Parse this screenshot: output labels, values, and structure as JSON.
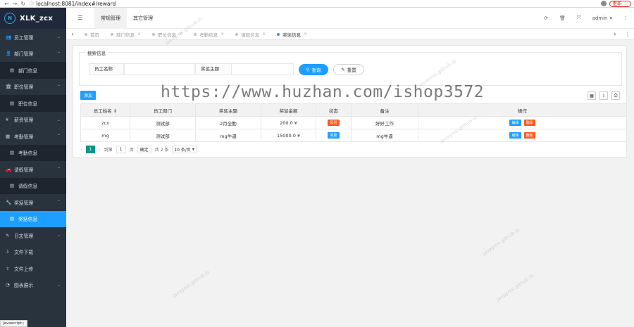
{
  "browser": {
    "url": "localhost:8081/index#/reward",
    "update_label": "更新"
  },
  "sidebar": {
    "brand": "XLK_zcx",
    "items": [
      {
        "label": "员工管理",
        "icon": "users-icon",
        "sub": false,
        "active": false
      },
      {
        "label": "部门管理",
        "icon": "user-icon",
        "sub": false,
        "active": false
      },
      {
        "label": "部门信息",
        "icon": "table-icon",
        "sub": true,
        "active": false
      },
      {
        "label": "职位管理",
        "icon": "bank-icon",
        "sub": false,
        "active": false
      },
      {
        "label": "职位信息",
        "icon": "table-icon",
        "sub": true,
        "active": false
      },
      {
        "label": "薪资管理",
        "icon": "money-icon",
        "sub": false,
        "active": false
      },
      {
        "label": "考勤管理",
        "icon": "calendar-icon",
        "sub": false,
        "active": false
      },
      {
        "label": "考勤信息",
        "icon": "table-icon",
        "sub": true,
        "active": false
      },
      {
        "label": "请假管理",
        "icon": "car-icon",
        "sub": false,
        "active": false
      },
      {
        "label": "请假信息",
        "icon": "table-icon",
        "sub": true,
        "active": false
      },
      {
        "label": "奖惩管理",
        "icon": "wrench-icon",
        "sub": false,
        "active": false
      },
      {
        "label": "奖惩信息",
        "icon": "table-icon",
        "sub": true,
        "active": true
      },
      {
        "label": "日志管理",
        "icon": "log-icon",
        "sub": false,
        "active": false
      },
      {
        "label": "文件下载",
        "icon": "download-icon",
        "sub": false,
        "active": false
      },
      {
        "label": "文件上传",
        "icon": "upload-icon",
        "sub": false,
        "active": false
      },
      {
        "label": "图表展示",
        "icon": "chart-icon",
        "sub": false,
        "active": false
      }
    ],
    "status_text": "javascript:;"
  },
  "topbar": {
    "nav": [
      "常规管理",
      "其它管理"
    ],
    "user": "admin"
  },
  "tabs": [
    "首页",
    "部门信息",
    "职位信息",
    "考勤信息",
    "请假信息",
    "奖惩信息"
  ],
  "search": {
    "legend": "搜索信息",
    "field1_label": "员工名称",
    "field2_label": "奖惩主题",
    "search_label": "查询",
    "reset_label": "重置"
  },
  "table": {
    "add_label": "添加",
    "headers": [
      "员工姓名",
      "员工部门",
      "奖惩主题",
      "奖惩金额",
      "状态",
      "备注",
      "操作"
    ],
    "rows": [
      {
        "name": "zcx",
        "dept": "测试部",
        "title": "2月全勤",
        "amount": "200.0 ¥",
        "status": "惩罚",
        "status_color": "#ff5722",
        "note": "好好工作"
      },
      {
        "name": "mg",
        "dept": "测试部",
        "title": "mg牛逼",
        "amount": "15000.0 ¥",
        "status": "奖励",
        "status_color": "#1e9fff",
        "note": "mg牛逼"
      }
    ],
    "edit_label": "编辑",
    "delete_label": "删除"
  },
  "pager": {
    "current": "1",
    "goto_label": "到第",
    "goto_value": "1",
    "page_unit": "页",
    "ok_label": "确定",
    "total": "共 2 条",
    "page_size": "10 条/页"
  },
  "watermark": "https://www.huzhan.com/ishop3572",
  "watermark_small": "javayms.github.io"
}
